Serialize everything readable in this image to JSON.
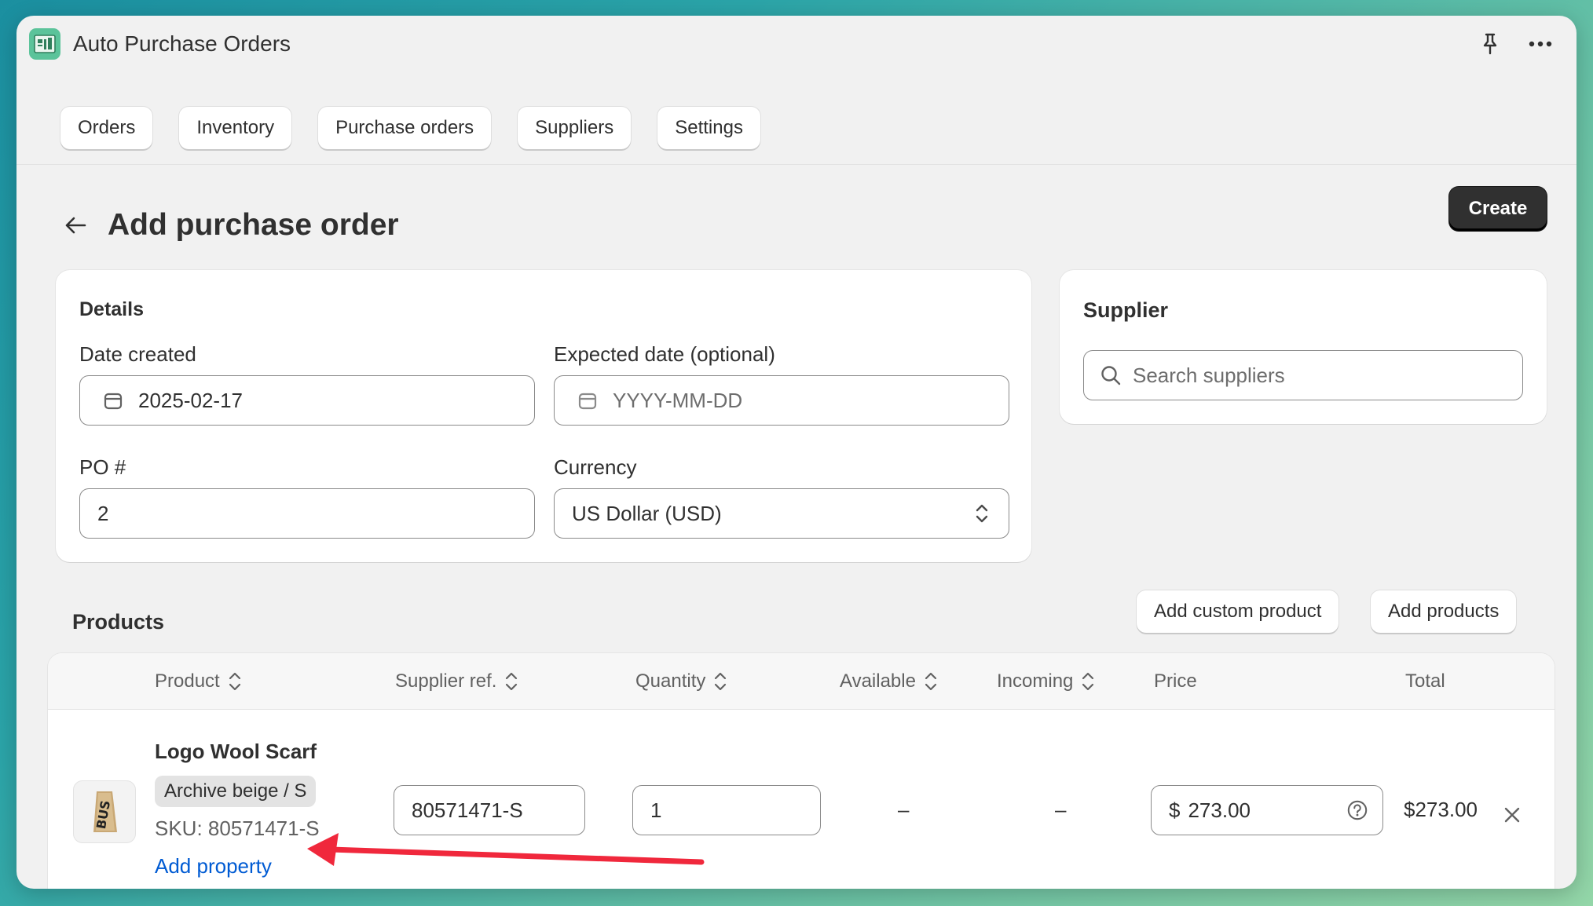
{
  "window": {
    "app_title": "Auto Purchase Orders",
    "icons": {
      "app": "app-logo-icon",
      "pin": "pin-icon",
      "more": "more-horizontal-icon"
    }
  },
  "nav": {
    "items": [
      {
        "label": "Orders"
      },
      {
        "label": "Inventory"
      },
      {
        "label": "Purchase orders"
      },
      {
        "label": "Suppliers"
      },
      {
        "label": "Settings"
      }
    ]
  },
  "page": {
    "title": "Add purchase order",
    "back_icon": "arrow-left-icon",
    "create_label": "Create"
  },
  "details": {
    "heading": "Details",
    "date_created": {
      "label": "Date created",
      "value": "2025-02-17",
      "icon": "calendar-icon"
    },
    "expected_date": {
      "label": "Expected date (optional)",
      "placeholder": "YYYY-MM-DD",
      "icon": "calendar-icon"
    },
    "po_number": {
      "label": "PO #",
      "value": "2"
    },
    "currency": {
      "label": "Currency",
      "value": "US Dollar (USD)",
      "icon": "select-chevron-icon"
    }
  },
  "supplier": {
    "heading": "Supplier",
    "search": {
      "placeholder": "Search suppliers",
      "icon": "search-icon"
    }
  },
  "products": {
    "heading": "Products",
    "add_custom_label": "Add custom product",
    "add_products_label": "Add products",
    "columns": [
      "Product",
      "Supplier ref.",
      "Quantity",
      "Available",
      "Incoming",
      "Price",
      "Total"
    ],
    "rows": [
      {
        "name": "Logo Wool Scarf",
        "variant": "Archive beige / S",
        "sku": "SKU: 80571471-S",
        "add_property": "Add property",
        "supplier_ref": "80571471-S",
        "quantity": "1",
        "available": "–",
        "incoming": "–",
        "price_prefix": "$",
        "price": "273.00",
        "total": "$273.00"
      }
    ]
  },
  "annotation": {
    "color": "#f0283c",
    "target": "Add property"
  }
}
